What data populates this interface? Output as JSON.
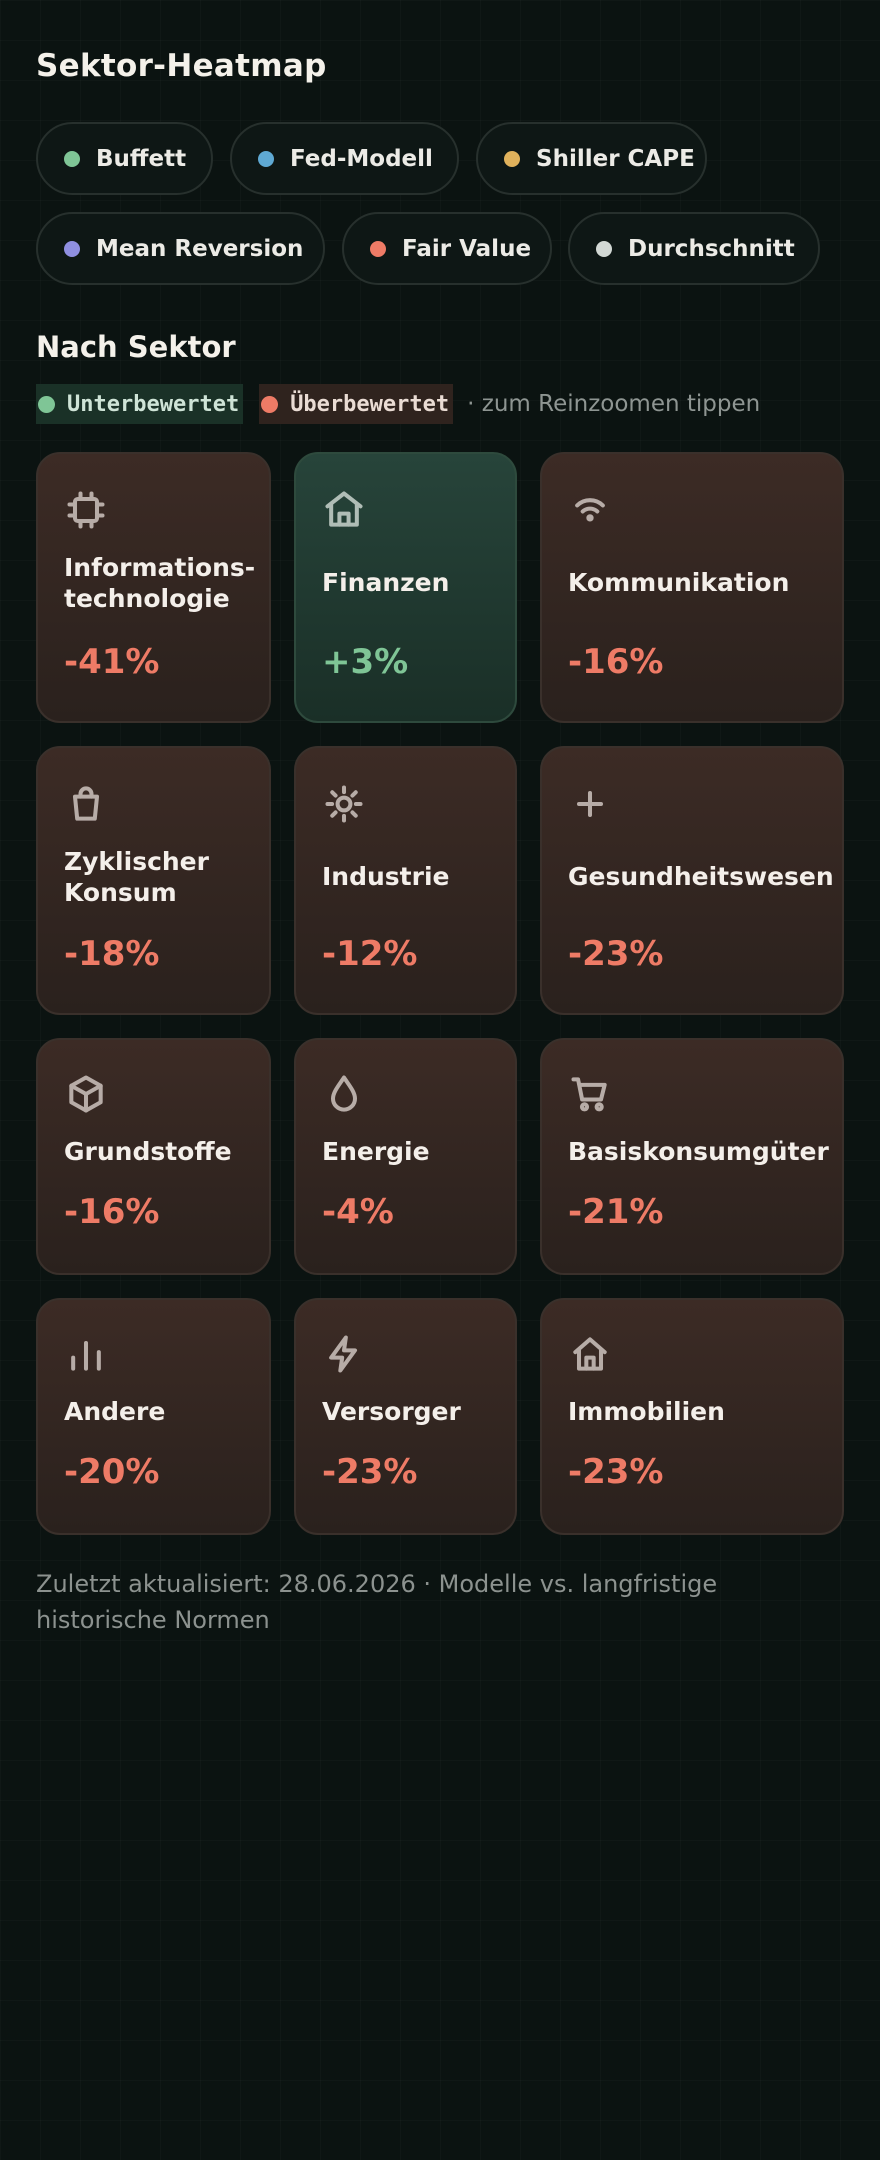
{
  "title": "Sektor-Heatmap",
  "models": [
    {
      "label": "Buffett",
      "color": "#7fc596"
    },
    {
      "label": "Fed-Modell",
      "color": "#5fa9d3"
    },
    {
      "label": "Shiller CAPE",
      "color": "#e0b25c"
    },
    {
      "label": "Mean Reversion",
      "color": "#8f8fe0"
    },
    {
      "label": "Fair Value",
      "color": "#ee7b66"
    },
    {
      "label": "Durchschnitt",
      "color": "#d2d8d4"
    }
  ],
  "section_title": "Nach Sektor",
  "legend": {
    "under": {
      "label": "Unterbewertet",
      "color": "#7fc596"
    },
    "over": {
      "label": "Überbewertet",
      "color": "#ee7b66"
    },
    "hint": "· zum Reinzoomen tippen"
  },
  "sectors": [
    {
      "name": "Informations- technologie",
      "value": "-41%",
      "icon": "chip-icon",
      "positive": false
    },
    {
      "name": "Finanzen",
      "value": "+3%",
      "icon": "bank-icon",
      "positive": true
    },
    {
      "name": "Kommunikation",
      "value": "-16%",
      "icon": "wifi-icon",
      "positive": false
    },
    {
      "name": "Zyklischer Konsum",
      "value": "-18%",
      "icon": "shopping-bag-icon",
      "positive": false
    },
    {
      "name": "Industrie",
      "value": "-12%",
      "icon": "gear-sun-icon",
      "positive": false
    },
    {
      "name": "Gesundheitswesen",
      "value": "-23%",
      "icon": "plus-icon",
      "positive": false
    },
    {
      "name": "Grundstoffe",
      "value": "-16%",
      "icon": "cube-icon",
      "positive": false
    },
    {
      "name": "Energie",
      "value": "-4%",
      "icon": "droplet-icon",
      "positive": false
    },
    {
      "name": "Basiskonsumgüter",
      "value": "-21%",
      "icon": "cart-icon",
      "positive": false
    },
    {
      "name": "Andere",
      "value": "-20%",
      "icon": "bar-chart-icon",
      "positive": false
    },
    {
      "name": "Versorger",
      "value": "-23%",
      "icon": "lightning-icon",
      "positive": false
    },
    {
      "name": "Immobilien",
      "value": "-23%",
      "icon": "house-icon",
      "positive": false
    }
  ],
  "footer": "Zuletzt aktualisiert: 28.06.2026 · Modelle vs. langfristige historische Normen"
}
